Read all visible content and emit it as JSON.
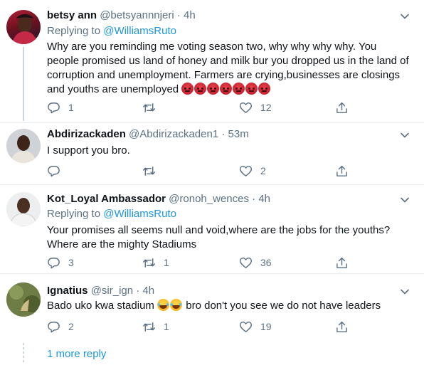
{
  "tweets": [
    {
      "name": "betsy ann",
      "handle": "@betsyannnjeri",
      "sep": "·",
      "time": "4h",
      "replying_label": "Replying to",
      "replying_to": "@WilliamsRuto",
      "text": "Why are you reminding me voting season two, why why why why. You people promised us land  of honey and milk bur you dropped us in the land of corruption and unemployment. Farmers are crying,businesses are closings and youths are unemployed",
      "replies": "1",
      "retweets": "",
      "likes": "12"
    },
    {
      "name": "Abdirizackaden",
      "handle": "@Abdirizackaden1",
      "sep": "·",
      "time": "53m",
      "text": "I support you bro.",
      "replies": "",
      "retweets": "",
      "likes": "2"
    },
    {
      "name": "Kot_Loyal Ambassador",
      "handle": "@ronoh_wences",
      "sep": "·",
      "time": "4h",
      "replying_label": "Replying to",
      "replying_to": "@WilliamsRuto",
      "text": "Your promises all seems null and void,where are the jobs for the youths? Where are the mighty Stadiums",
      "replies": "3",
      "retweets": "1",
      "likes": "36"
    },
    {
      "name": "Ignatius",
      "handle": "@sir_ign",
      "sep": "·",
      "time": "4h",
      "text_before": "Bado uko kwa stadium ",
      "text_after": " bro don't you see we do not have leaders",
      "replies": "2",
      "retweets": "1",
      "likes": "19"
    }
  ],
  "more_replies": "1 more reply",
  "colors": {
    "link": "#1b95e0",
    "muted": "#5b7083",
    "divider": "#e6ecf0",
    "thread_line": "#ccd6dd"
  },
  "icons": [
    "chevron-down-icon",
    "reply-icon",
    "retweet-icon",
    "like-icon",
    "share-icon",
    "angry-face-emoji",
    "laughing-tears-emoji"
  ]
}
